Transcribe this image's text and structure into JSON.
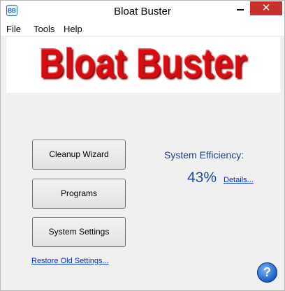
{
  "window": {
    "title": "Bloat Buster",
    "icon_label": "BB",
    "minimize_icon": "minimize-icon",
    "close_symbol": "✕"
  },
  "menu": {
    "items": [
      "File",
      "Tools",
      "Help"
    ]
  },
  "logo": {
    "text": "Bloat Buster"
  },
  "buttons": {
    "cleanup_wizard": "Cleanup Wizard",
    "programs": "Programs",
    "system_settings": "System Settings"
  },
  "links": {
    "restore": "Restore Old Settings...",
    "details": "Details..."
  },
  "efficiency": {
    "label": "System Efficiency:",
    "value": "43%"
  },
  "help": {
    "symbol": "?"
  },
  "colors": {
    "logo_red": "#d40d14",
    "close_red": "#c7302b",
    "link_blue": "#0033cc",
    "efficiency_blue": "#1f4d9e"
  }
}
